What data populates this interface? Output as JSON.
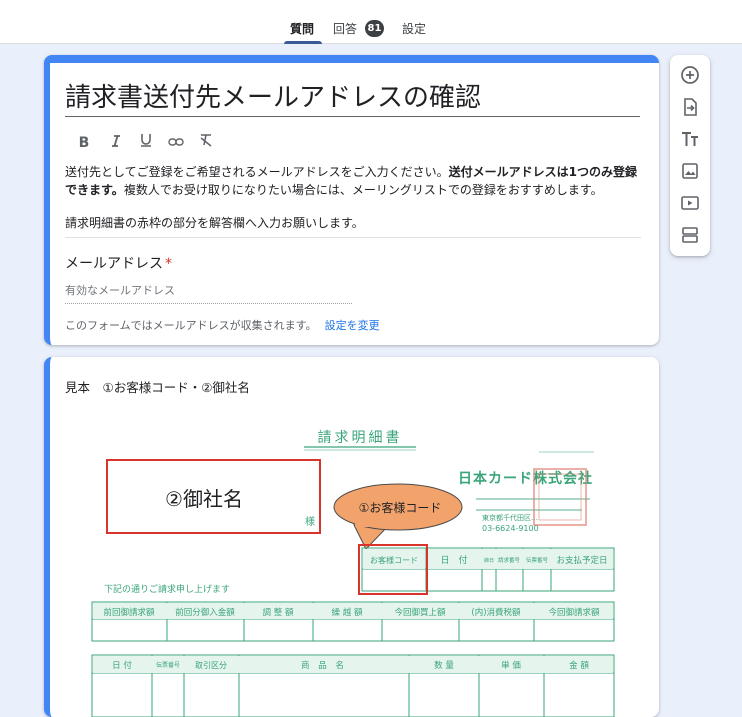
{
  "tabs": {
    "questions": "質問",
    "responses": "回答",
    "responses_count": "81",
    "settings": "設定"
  },
  "form": {
    "title": "請求書送付先メールアドレスの確認",
    "format_icons": [
      "bold-icon",
      "italic-icon",
      "underline-icon",
      "link-icon",
      "clear-format-icon"
    ],
    "description_1_pre": "送付先としてご登録をご希望されるメールアドレスをご入力ください。",
    "description_1_bold": "送付メールアドレスは1つのみ登録できます。",
    "description_1_post": "複数人でお受け取りになりたい場合には、メーリングリストでの登録をおすすめします。",
    "description_2": "請求明細書の赤枠の部分を解答欄へ入力お願いします。",
    "email_question_label": "メールアドレス",
    "required_mark": "*",
    "email_placeholder": "有効なメールアドレス",
    "collect_notice": "このフォームではメールアドレスが収集されます。",
    "change_settings_link": "設定を変更"
  },
  "image_item": {
    "label": "見本　①お客様コード・②御社名",
    "invoice": {
      "heading": "請求明細書",
      "customer_name_box": "②御社名",
      "honorific": "様",
      "bubble": "①お客様コード",
      "company": "日本カード株式会社",
      "branch_line": "東京都千代田区…",
      "phone": "03-6624-9100",
      "intro_text": "下記の通りご請求申し上げます",
      "top_table_headers": [
        "お客様コード",
        "日　付",
        "締日",
        "請求番号",
        "伝票番号",
        "お支払予定日"
      ],
      "summary_headers": [
        "前回御請求額",
        "前回分御入金額",
        "調 整 額",
        "繰 越 額",
        "今回御買上額",
        "(内)消費税額",
        "今回御請求額"
      ],
      "detail_headers": [
        "日 付",
        "伝票番号",
        "取引区分",
        "商 品 名",
        "数 量",
        "単 価",
        "金 額"
      ]
    }
  },
  "toolbar": [
    "add-question-icon",
    "import-questions-icon",
    "add-title-icon",
    "add-image-icon",
    "add-video-icon",
    "add-section-icon"
  ],
  "colors": {
    "accent": "#4285f4",
    "tab_underline": "#3a5a97",
    "invoice_green": "#3aa57a",
    "highlight_red": "#d9342b",
    "bubble_fill": "#f2a36c"
  }
}
